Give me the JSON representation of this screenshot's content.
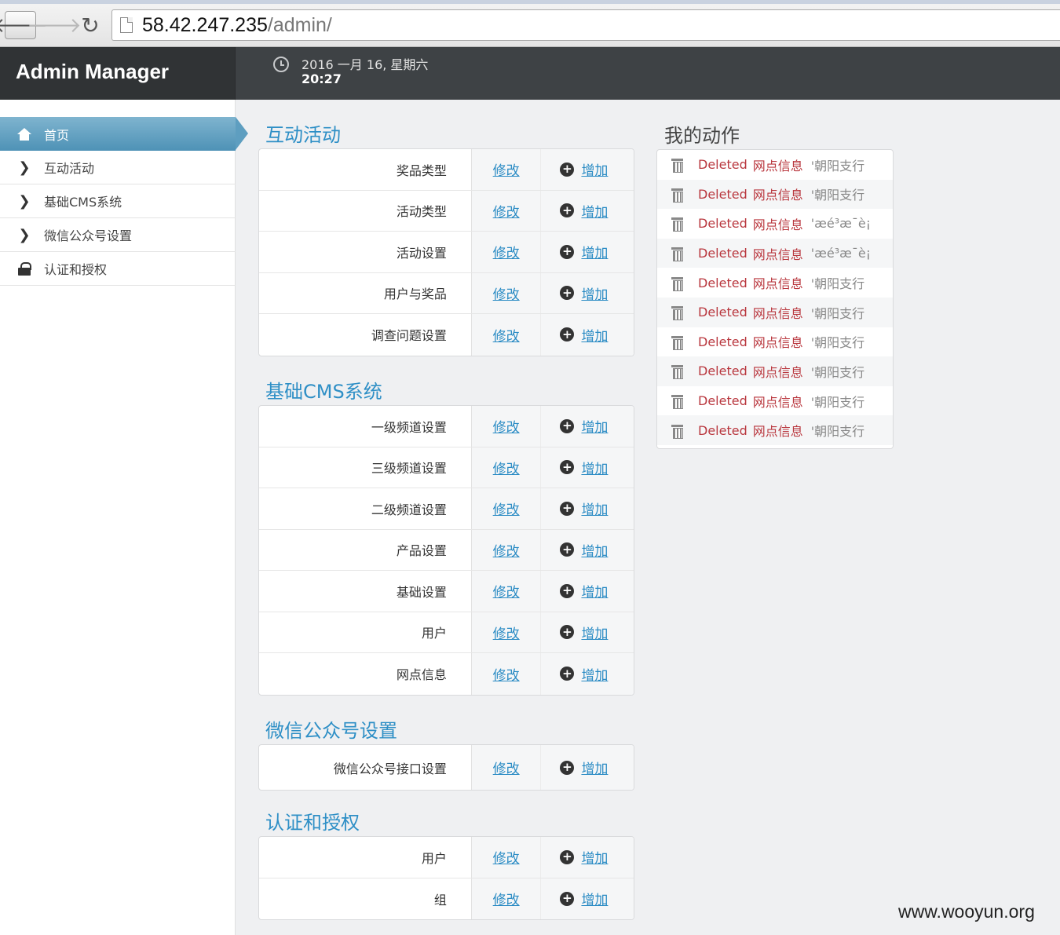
{
  "browser": {
    "url_host": "58.42.247.235",
    "url_path": "/admin/",
    "back_glyph": "🡐",
    "forward_glyph": "🡒",
    "reload_glyph": "↻"
  },
  "header": {
    "brand": "Admin Manager",
    "date": "2016 一月 16, 星期六",
    "time": "20:27"
  },
  "sidebar": {
    "items": [
      {
        "label": "首页",
        "icon": "home-icon",
        "active": true
      },
      {
        "label": "互动活动",
        "icon": "chevron-right-icon"
      },
      {
        "label": "基础CMS系统",
        "icon": "chevron-right-icon"
      },
      {
        "label": "微信公众号设置",
        "icon": "chevron-right-icon"
      },
      {
        "label": "认证和授权",
        "icon": "lock-icon"
      }
    ]
  },
  "links": {
    "change": "修改",
    "add": "增加"
  },
  "modules": [
    {
      "title": "互动活动",
      "rows": [
        "奖品类型",
        "活动类型",
        "活动设置",
        "用户与奖品",
        "调查问题设置"
      ]
    },
    {
      "title": "基础CMS系统",
      "rows": [
        "一级频道设置",
        "三级频道设置",
        "二级频道设置",
        "产品设置",
        "基础设置",
        "用户",
        "网点信息"
      ]
    },
    {
      "title": "微信公众号设置",
      "rows": [
        "微信公众号接口设置"
      ]
    },
    {
      "title": "认证和授权",
      "rows": [
        "用户",
        "组"
      ]
    }
  ],
  "recent_actions": {
    "title": "我的动作",
    "items": [
      {
        "verb": "Deleted",
        "model": "网点信息",
        "object": "'朝阳支行"
      },
      {
        "verb": "Deleted",
        "model": "网点信息",
        "object": "'朝阳支行"
      },
      {
        "verb": "Deleted",
        "model": "网点信息",
        "object": "'æé³æ¯è¡"
      },
      {
        "verb": "Deleted",
        "model": "网点信息",
        "object": "'æé³æ¯è¡"
      },
      {
        "verb": "Deleted",
        "model": "网点信息",
        "object": "'朝阳支行"
      },
      {
        "verb": "Deleted",
        "model": "网点信息",
        "object": "'朝阳支行"
      },
      {
        "verb": "Deleted",
        "model": "网点信息",
        "object": "'朝阳支行"
      },
      {
        "verb": "Deleted",
        "model": "网点信息",
        "object": "'朝阳支行"
      },
      {
        "verb": "Deleted",
        "model": "网点信息",
        "object": "'朝阳支行"
      },
      {
        "verb": "Deleted",
        "model": "网点信息",
        "object": "'朝阳支行"
      }
    ]
  },
  "watermark": "www.wooyun.org",
  "colors": {
    "accent": "#2e8fc6",
    "header_bg": "#3e4245",
    "deleted_red": "#b9373e"
  }
}
